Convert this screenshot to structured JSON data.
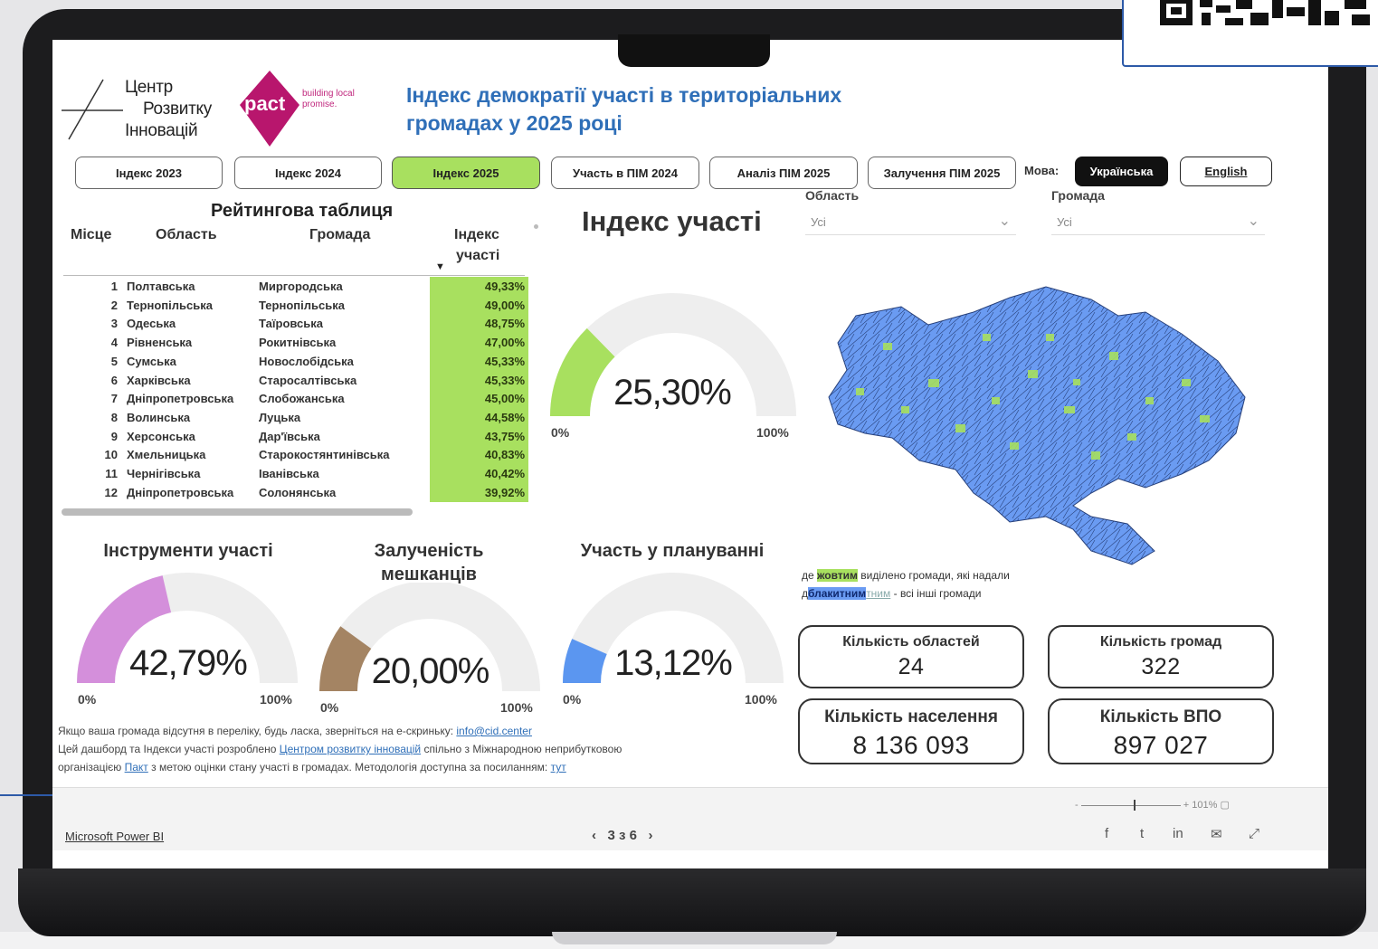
{
  "header": {
    "logo_cid_line1": "Центр",
    "logo_cid_line2": "Розвитку",
    "logo_cid_line3": "Інновацій",
    "logo_pact_word": "pact",
    "logo_pact_tagline": "building local promise.",
    "title": "Індекс демократії участі в територіальних громадах у 2025 році"
  },
  "tabs": [
    {
      "label": "Індекс 2023",
      "active": false
    },
    {
      "label": "Індекс 2024",
      "active": false
    },
    {
      "label": "Індекс 2025",
      "active": true
    },
    {
      "label": "Участь в ПІМ 2024",
      "active": false
    },
    {
      "label": "Аналіз ПІМ 2025",
      "active": false
    },
    {
      "label": "Залучення ПІМ 2025",
      "active": false
    }
  ],
  "language": {
    "label": "Мова:",
    "ukrainian": "Українська",
    "english": "English",
    "selected": "Українська"
  },
  "filters": {
    "region_label": "Область",
    "region_value": "Усі",
    "community_label": "Громада",
    "community_value": "Усі"
  },
  "ranking": {
    "title": "Рейтингова таблиця",
    "columns": [
      "Місце",
      "Область",
      "Громада",
      "Індекс участі"
    ],
    "index_col_line1": "Індекс",
    "index_col_line2": "участі",
    "rows": [
      {
        "rank": "1",
        "region": "Полтавська",
        "community": "Миргородська",
        "value": "49,33%"
      },
      {
        "rank": "2",
        "region": "Тернопільська",
        "community": "Тернопільська",
        "value": "49,00%"
      },
      {
        "rank": "3",
        "region": "Одеська",
        "community": "Таїровська",
        "value": "48,75%"
      },
      {
        "rank": "4",
        "region": "Рівненська",
        "community": "Рокитнівська",
        "value": "47,00%"
      },
      {
        "rank": "5",
        "region": "Сумська",
        "community": "Новослобідська",
        "value": "45,33%"
      },
      {
        "rank": "6",
        "region": "Харківська",
        "community": "Старосалтівська",
        "value": "45,33%"
      },
      {
        "rank": "7",
        "region": "Дніпропетровська",
        "community": "Слобожанська",
        "value": "45,00%"
      },
      {
        "rank": "8",
        "region": "Волинська",
        "community": "Луцька",
        "value": "44,58%"
      },
      {
        "rank": "9",
        "region": "Херсонська",
        "community": "Дар'ївська",
        "value": "43,75%"
      },
      {
        "rank": "10",
        "region": "Хмельницька",
        "community": "Старокостянтинівська",
        "value": "40,83%"
      },
      {
        "rank": "11",
        "region": "Чернігівська",
        "community": "Іванівська",
        "value": "40,42%"
      },
      {
        "rank": "12",
        "region": "Дніпропетровська",
        "community": "Солонянська",
        "value": "39,92%"
      }
    ]
  },
  "gauges": {
    "main": {
      "title": "Індекс участі",
      "value_text": "25,30%",
      "fraction": 0.253,
      "min": "0%",
      "max": "100%",
      "color": "#a8e05f"
    },
    "tools": {
      "title": "Інструменти участі",
      "value_text": "42,79%",
      "fraction": 0.4279,
      "min": "0%",
      "max": "100%",
      "color": "#d48fdb"
    },
    "engagement": {
      "title_line1": "Залученість",
      "title_line2": "мешканців",
      "value_text": "20,00%",
      "fraction": 0.2,
      "min": "0%",
      "max": "100%",
      "color": "#a48463"
    },
    "planning": {
      "title": "Участь у плануванні",
      "value_text": "13,12%",
      "fraction": 0.1312,
      "min": "0%",
      "max": "100%",
      "color": "#5b96f0"
    }
  },
  "map_legend": {
    "part1": "де",
    "yellow": "жовтим",
    "part2": "виділено громади, які надали",
    "part3": "д",
    "blue": "блакитним",
    "faded": "тним",
    "part4": "- всі інші громади"
  },
  "kpis": {
    "regions_label": "Кількість областей",
    "regions_value": "24",
    "communities_label": "Кількість громад",
    "communities_value": "322",
    "population_label": "Кількість населення",
    "population_value": "8 136 093",
    "idp_label": "Кількість ВПО",
    "idp_value": "897 027"
  },
  "footer_text": {
    "line1": "Якщо ваша громада відсутня в переліку, будь ласка, зверніться на е-скриньку:",
    "email": "info@cid.center",
    "line2a": "Цей дашборд та Індекси участі розроблено",
    "line2_link": "Центром розвитку інновацій",
    "line2b": "спільно з Міжнародною неприбутковою",
    "line3a": "організацією",
    "line3_link": "Пакт",
    "line3b": "з метою оцінки стану участі в громадах. Методологія доступна за посиланням:",
    "line3_link2": "тут"
  },
  "powerbi": {
    "brand": "Microsoft Power BI",
    "page": "3 з 6",
    "zoom_pct": "101%"
  },
  "colors": {
    "accent_green": "#a8e05f",
    "title_blue": "#2f6fb8",
    "map_blue": "#6a9bf2"
  }
}
